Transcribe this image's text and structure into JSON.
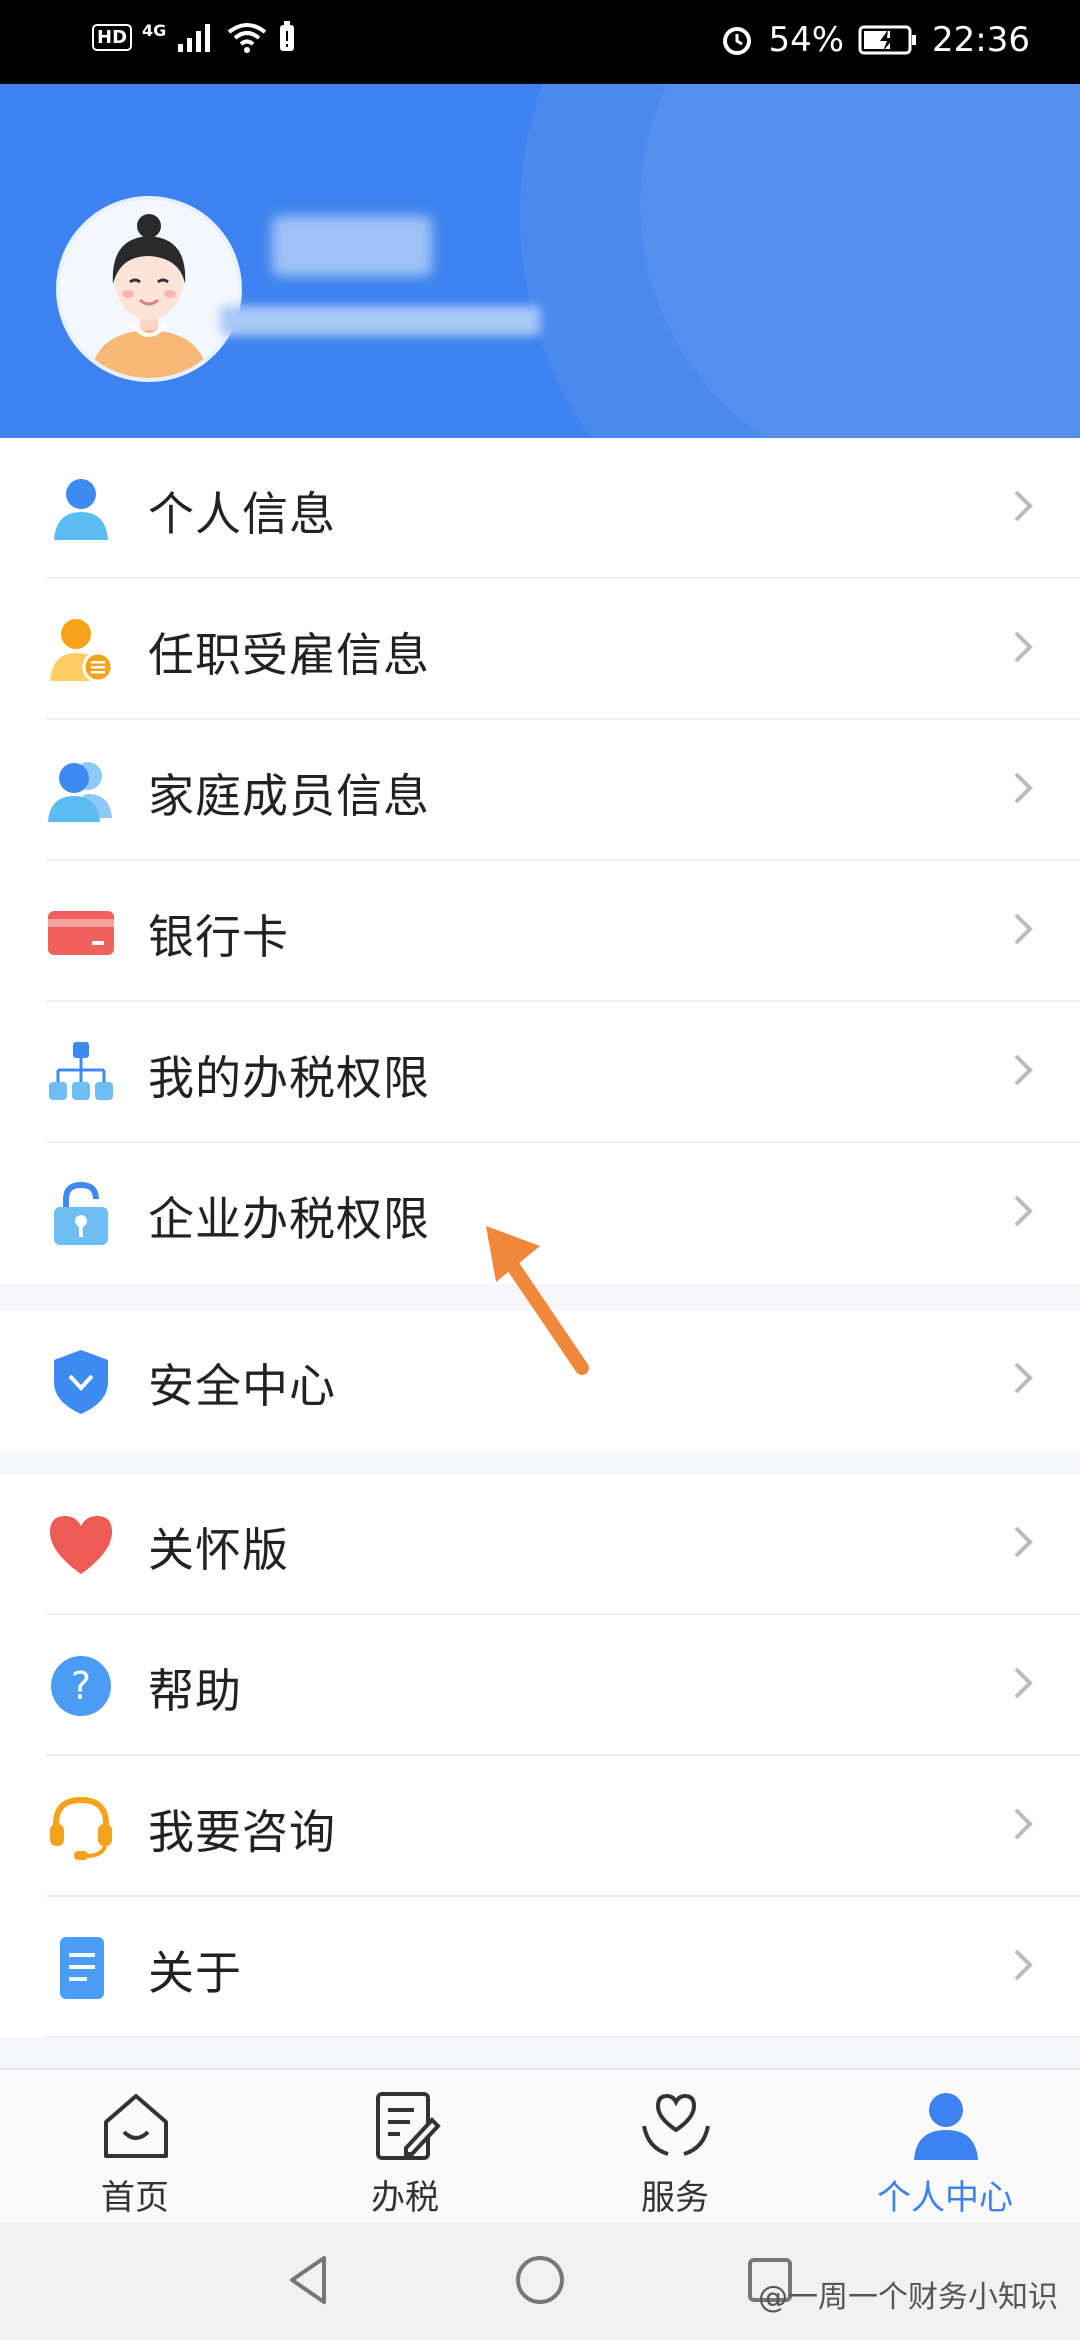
{
  "status_bar": {
    "left_indicators": [
      "HD",
      "4G"
    ],
    "battery": "54%",
    "time": "22:36"
  },
  "profile": {
    "avatar_icon": "avatar-woman-icon"
  },
  "menu": {
    "group1": [
      {
        "label": "个人信息",
        "icon": "person-icon"
      },
      {
        "label": "任职受雇信息",
        "icon": "employment-icon"
      },
      {
        "label": "家庭成员信息",
        "icon": "family-icon"
      },
      {
        "label": "银行卡",
        "icon": "bank-card-icon"
      },
      {
        "label": "我的办税权限",
        "icon": "org-chart-icon"
      },
      {
        "label": "企业办税权限",
        "icon": "unlock-icon"
      }
    ],
    "group2": [
      {
        "label": "安全中心",
        "icon": "shield-icon"
      }
    ],
    "group3": [
      {
        "label": "关怀版",
        "icon": "heart-icon"
      },
      {
        "label": "帮助",
        "icon": "help-icon"
      },
      {
        "label": "我要咨询",
        "icon": "headset-icon"
      },
      {
        "label": "关于",
        "icon": "document-icon"
      }
    ]
  },
  "tabs": [
    {
      "label": "首页",
      "icon": "home-icon",
      "active": false
    },
    {
      "label": "办税",
      "icon": "tax-form-icon",
      "active": false
    },
    {
      "label": "服务",
      "icon": "service-heart-icon",
      "active": false
    },
    {
      "label": "个人中心",
      "icon": "profile-icon",
      "active": true
    }
  ],
  "watermark": "@一周一个财务小知识",
  "colors": {
    "brand_blue": "#3d82ee",
    "annotation_arrow": "#f0883c",
    "active_tab": "#3d82ee"
  }
}
